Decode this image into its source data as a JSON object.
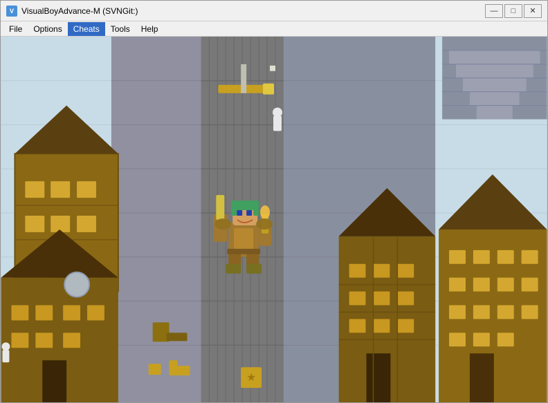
{
  "window": {
    "title": "VisualBoyAdvance-M (SVNGit:)",
    "icon_label": "V"
  },
  "title_controls": {
    "minimize": "—",
    "maximize": "□",
    "close": "✕"
  },
  "menu": {
    "items": [
      {
        "id": "file",
        "label": "File"
      },
      {
        "id": "options",
        "label": "Options"
      },
      {
        "id": "cheats",
        "label": "Cheats"
      },
      {
        "id": "tools",
        "label": "Tools"
      },
      {
        "id": "help",
        "label": "Help"
      }
    ]
  }
}
